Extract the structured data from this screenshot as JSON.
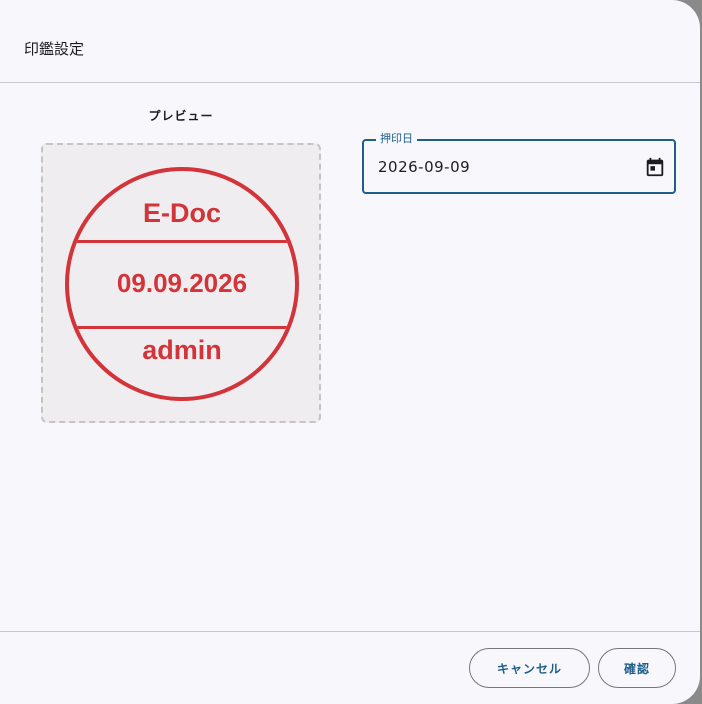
{
  "dialog": {
    "title": "印鑑設定"
  },
  "preview": {
    "label": "プレビュー",
    "stamp": {
      "line1": "E-Doc",
      "line2": "09.09.2026",
      "line3": "admin",
      "color": "#d3343a"
    }
  },
  "date_field": {
    "label": "押印日",
    "value": "2026-09-09",
    "icon": "calendar-icon"
  },
  "actions": {
    "cancel_label": "キャンセル",
    "confirm_label": "確認"
  },
  "colors": {
    "accent": "#1f5f8c",
    "stamp_red": "#d3343a",
    "surface": "#f8f7fc"
  }
}
